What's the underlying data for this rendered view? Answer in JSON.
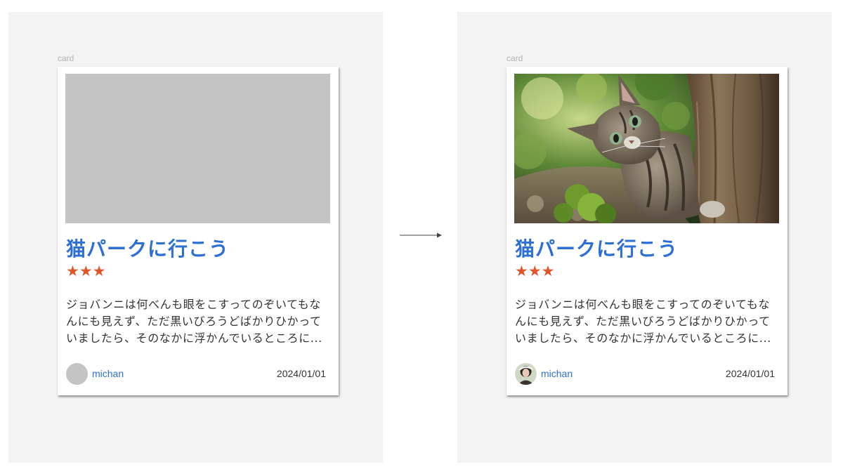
{
  "frames": {
    "before": {
      "label": "card",
      "title": "猫パークに行こう",
      "rating_stars": "★★★",
      "excerpt": "ジョバンニは何べんも眼をこすってのぞいてもなんにも見えず、ただ黒いびろうどばかりひかっていましたら、そのなかに浮かんでいるところに...",
      "author": "michan",
      "date": "2024/01/01"
    },
    "after": {
      "label": "card",
      "title": "猫パークに行こう",
      "rating_stars": "★★★",
      "excerpt": "ジョバンニは何べんも眼をこすってのぞいてもなんにも見えず、ただ黒いびろうどばかりひかっていましたら、そのなかに浮かんでいるところに...",
      "author": "michan",
      "date": "2024/01/01"
    }
  },
  "colors": {
    "title": "#2e6fd6",
    "stars": "#e0562c",
    "placeholder": "#c4c4c4",
    "panel_bg": "#f3f3f3"
  },
  "icons": {
    "arrow": "right-arrow-icon"
  }
}
